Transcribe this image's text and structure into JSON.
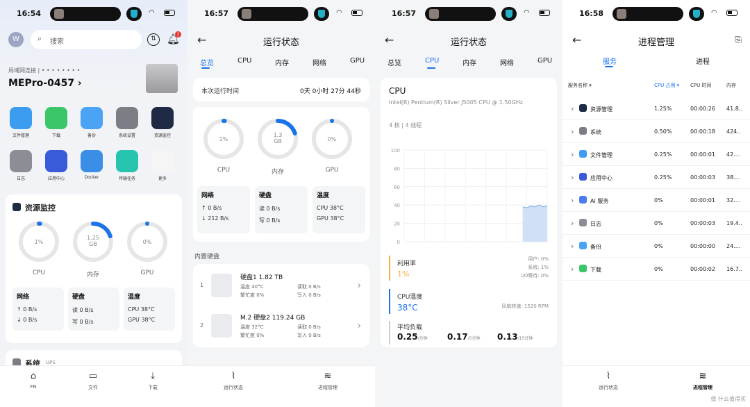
{
  "status": {
    "times": [
      "16:54",
      "16:57",
      "16:57",
      "16:58"
    ]
  },
  "colors": {
    "accent": "#1a73e8",
    "warn": "#f5b041",
    "ring_track": "#e6e6e6"
  },
  "home": {
    "avatar_letter": "W",
    "search_placeholder": "搜索",
    "notif_count": "1",
    "lan_status": "局域网连接 | • • • • • • • •",
    "device_name": "MEPro-0457 ›",
    "apps": [
      {
        "label": "文件管理",
        "icon": "folder-icon",
        "color": "#3b9cf0"
      },
      {
        "label": "下载",
        "icon": "download-icon",
        "color": "#3cc66a"
      },
      {
        "label": "备份",
        "icon": "backup-icon",
        "color": "#4ba3f5"
      },
      {
        "label": "系统设置",
        "icon": "settings-icon",
        "color": "#7d7d85"
      },
      {
        "label": "资源监控",
        "icon": "monitor-icon",
        "color": "#1f2a44"
      },
      {
        "label": "日志",
        "icon": "log-icon",
        "color": "#8d8d95"
      },
      {
        "label": "应用中心",
        "icon": "store-icon",
        "color": "#3a5bd9"
      },
      {
        "label": "Docker",
        "icon": "docker-icon",
        "color": "#3a8ee6"
      },
      {
        "label": "传输任务",
        "icon": "transfer-icon",
        "color": "#27c4b0"
      },
      {
        "label": "更多",
        "icon": "more-icon",
        "color": "#f5f5f5"
      }
    ],
    "monitor_title": "资源监控",
    "rings": [
      {
        "label": "CPU",
        "value": "1%",
        "pct": 0.01
      },
      {
        "label": "内存",
        "value": "1.25\nGB",
        "pct": 0.2
      },
      {
        "label": "GPU",
        "value": "0%",
        "pct": 0
      }
    ],
    "net_title": "网络",
    "net_up": "↑ 0 B/s",
    "net_down": "↓ 0 B/s",
    "disk_title": "硬盘",
    "disk_read": "读 0 B/s",
    "disk_write": "写 0 B/s",
    "temp_title": "温度",
    "temp_cpu": "CPU 38°C",
    "temp_gpu": "GPU 38°C",
    "system_card_title": "系统",
    "system_card_sub": "UPS",
    "nav": [
      {
        "label": "FN",
        "icon": "home-icon"
      },
      {
        "label": "文件",
        "icon": "folder-icon"
      },
      {
        "label": "下载",
        "icon": "download-icon"
      }
    ]
  },
  "status_page": {
    "title": "运行状态",
    "tabs": [
      "总览",
      "CPU",
      "内存",
      "网络",
      "GPU"
    ],
    "uptime_label": "本次运行时间",
    "uptime_value": "0天 0小时 27分 44秒",
    "rings": [
      {
        "label": "CPU",
        "value": "1%",
        "pct": 0.01
      },
      {
        "label": "内存",
        "value": "1.3\nGB",
        "pct": 0.2
      },
      {
        "label": "GPU",
        "value": "0%",
        "pct": 0
      }
    ],
    "net_title": "网络",
    "net_up": "↑ 0 B/s",
    "net_down": "↓ 212 B/s",
    "disk_title": "硬盘",
    "disk_read": "读 0 B/s",
    "disk_write": "写 0 B/s",
    "temp_title": "温度",
    "temp_cpu": "CPU 38°C",
    "temp_gpu": "GPU 38°C",
    "disks_title": "内置硬盘",
    "disks": [
      {
        "idx": "1",
        "name": "硬盘1 1.82 TB",
        "temp": "温度   40°C",
        "busy": "繁忙度 0%",
        "read": "读取   0 B/s",
        "write": "写入   0 B/s"
      },
      {
        "idx": "2",
        "name": "M.2 硬盘2 119.24 GB",
        "temp": "温度   32°C",
        "busy": "繁忙度 0%",
        "read": "读取   0 B/s",
        "write": "写入   0 B/s"
      }
    ],
    "nav": [
      {
        "label": "运行状态",
        "icon": "chart-icon"
      },
      {
        "label": "进程管理",
        "icon": "layers-icon"
      }
    ]
  },
  "cpu_page": {
    "title": "运行状态",
    "tabs": [
      "总览",
      "CPU",
      "内存",
      "网络",
      "GPU"
    ],
    "cpu_title": "CPU",
    "cpu_model": "Intel(R) Pentium(R) Silver J5005 CPU @ 1.50GHz",
    "cores": "4 核",
    "threads": "4 线程",
    "usage_label": "利用率",
    "usage_value": "1%",
    "user": "用户:   0%",
    "system": "系统:   1%",
    "iowait": "I/O等待:   0%",
    "temp_label": "CPU温度",
    "temp_value": "38°C",
    "fan": "风扇转速: 1520 RPM",
    "load_label": "平均负载",
    "loads": [
      {
        "v": "0.25",
        "u": "/分钟"
      },
      {
        "v": "0.17",
        "u": "/5分钟"
      },
      {
        "v": "0.13",
        "u": "/15分钟"
      }
    ]
  },
  "chart_data": {
    "type": "area",
    "yticks": [
      "100",
      "80",
      "60",
      "40",
      "20",
      "0"
    ],
    "ylim": [
      0,
      100
    ],
    "x": [
      0,
      1,
      2,
      3,
      4,
      5,
      6,
      7,
      8,
      9,
      10,
      11,
      12,
      13,
      14,
      15,
      16,
      17,
      18,
      19,
      20,
      21,
      22,
      23,
      24,
      25,
      26,
      27,
      28,
      29,
      30,
      31,
      32,
      33,
      34,
      35
    ],
    "values": [
      null,
      null,
      null,
      null,
      null,
      null,
      null,
      null,
      null,
      null,
      null,
      null,
      null,
      null,
      null,
      null,
      null,
      null,
      null,
      null,
      null,
      null,
      null,
      null,
      null,
      null,
      null,
      null,
      null,
      38,
      37,
      39,
      38,
      40,
      38,
      39
    ]
  },
  "proc_page": {
    "title": "进程管理",
    "tabs": [
      "服务",
      "进程"
    ],
    "headers": [
      "服务名称 ▾",
      "CPU 占用 ▾",
      "CPU 时间",
      "内存"
    ],
    "rows": [
      {
        "name": "资源管理",
        "cpu": "1.25%",
        "time": "00:00:26",
        "mem": "41.8..",
        "color": "#1f2a44"
      },
      {
        "name": "系统",
        "cpu": "0.50%",
        "time": "00:00:18",
        "mem": "424..",
        "color": "#7d7d85"
      },
      {
        "name": "文件管理",
        "cpu": "0.25%",
        "time": "00:00:01",
        "mem": "42....",
        "color": "#3b9cf0"
      },
      {
        "name": "应用中心",
        "cpu": "0.25%",
        "time": "00:00:03",
        "mem": "38....",
        "color": "#3a5bd9"
      },
      {
        "name": "AI 服务",
        "cpu": "0%",
        "time": "00:00:01",
        "mem": "32....",
        "color": "#4b7bec"
      },
      {
        "name": "日志",
        "cpu": "0%",
        "time": "00:00:03",
        "mem": "19.4..",
        "color": "#8d8d95"
      },
      {
        "name": "备份",
        "cpu": "0%",
        "time": "00:00:00",
        "mem": "24....",
        "color": "#4ba3f5"
      },
      {
        "name": "下载",
        "cpu": "0%",
        "time": "00:00:02",
        "mem": "16.7..",
        "color": "#3cc66a"
      }
    ],
    "nav": [
      {
        "label": "运行状态",
        "icon": "chart-icon"
      },
      {
        "label": "进程管理",
        "icon": "layers-icon"
      }
    ],
    "watermark": "值 什么值得买"
  }
}
